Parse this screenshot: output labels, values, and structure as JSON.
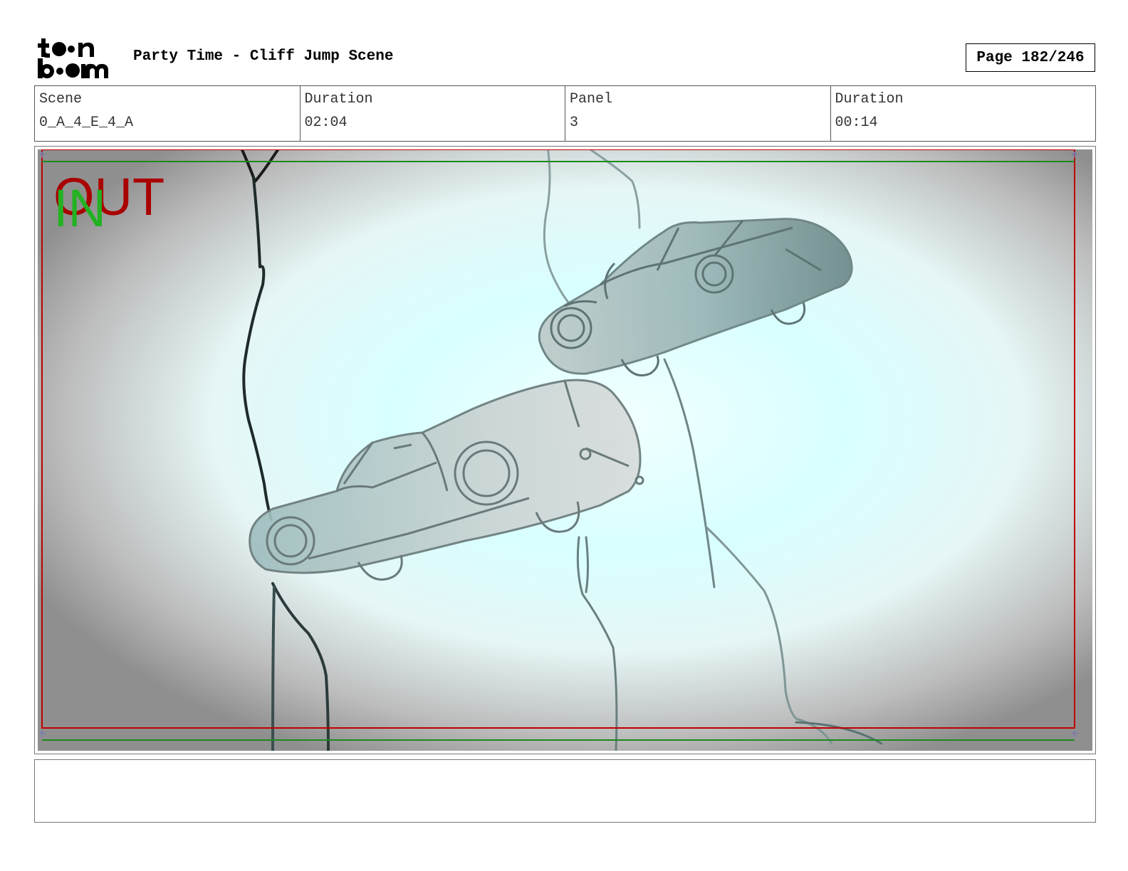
{
  "header": {
    "logo_text": "toon boom",
    "title": "Party Time - Cliff Jump Scene",
    "page_label": "Page 182/246"
  },
  "info": {
    "scene_label": "Scene",
    "scene_value": "0_A_4_E_4_A",
    "scene_duration_label": "Duration",
    "scene_duration_value": "02:04",
    "panel_label": "Panel",
    "panel_value": "3",
    "panel_duration_label": "Duration",
    "panel_duration_value": "00:14"
  },
  "panel": {
    "out_label": "OUT",
    "in_label": "IN",
    "colors": {
      "out_frame": "#c00000",
      "in_frame": "#1c8a1c",
      "sky_glow": "#d8ffff",
      "vignette": "#8f8f8f"
    },
    "illustration": "two cars falling past cliff outlines"
  },
  "notes": {
    "text": ""
  }
}
